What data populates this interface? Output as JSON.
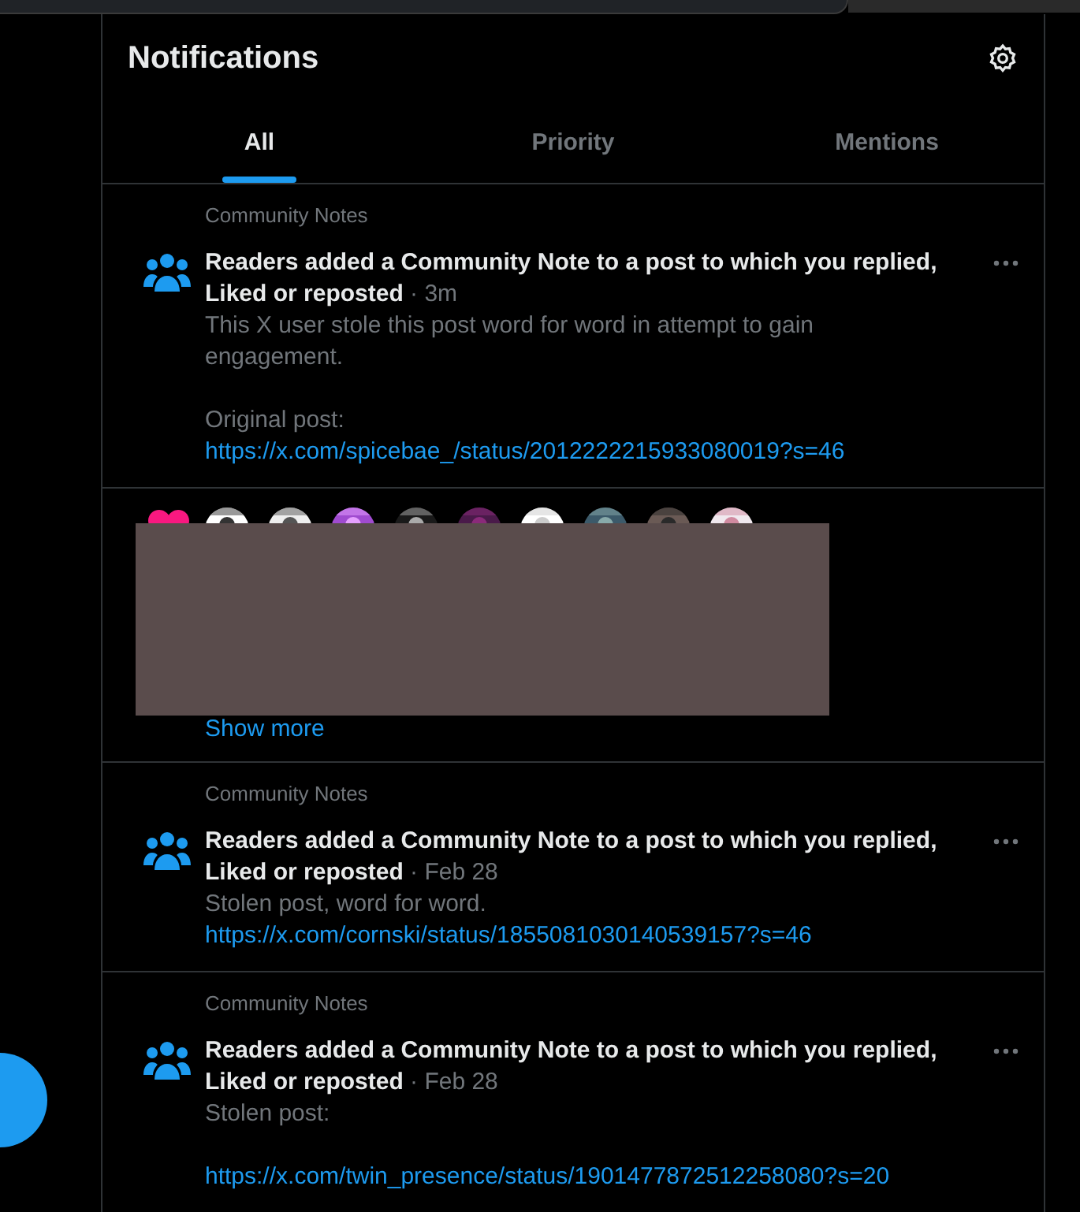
{
  "header": {
    "title": "Notifications"
  },
  "tabs": [
    {
      "label": "All",
      "selected": true
    },
    {
      "label": "Priority",
      "selected": false
    },
    {
      "label": "Mentions",
      "selected": false
    }
  ],
  "notifications": [
    {
      "kind": "note",
      "category": "Community Notes",
      "title": "Readers added a Community Note to a post to which you replied, Liked or reposted",
      "time": "· 3m",
      "body": "This X user stole this post word for word in attempt to gain engagement.\n\nOriginal post:",
      "link": "https://x.com/spicebae_/status/2012222215933080019?s=46"
    },
    {
      "kind": "group",
      "redacted": true,
      "more": "Show more"
    },
    {
      "kind": "note",
      "category": "Community Notes",
      "title": "Readers added a Community Note to a post to which you replied, Liked or reposted",
      "time": "· Feb 28",
      "body": "Stolen post, word for word.",
      "link": "https://x.com/cornski/status/1855081030140539157?s=46"
    },
    {
      "kind": "note",
      "category": "Community Notes",
      "title": "Readers added a Community Note to a post to which you replied, Liked or reposted",
      "time": "· Feb 28",
      "body": "Stolen post:\n",
      "link": "https://x.com/twin_presence/status/1901477872512258080?s=20"
    }
  ]
}
